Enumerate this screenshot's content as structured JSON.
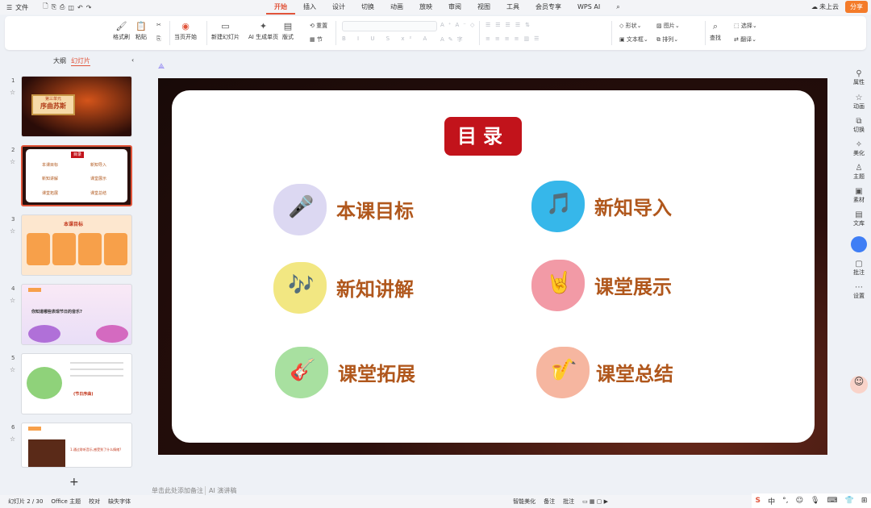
{
  "titlebar": {
    "menu_icon": "hamburger-icon",
    "file": "文件",
    "quick_icons": [
      "save-icon",
      "export-icon",
      "print-icon",
      "preview-icon",
      "undo-icon",
      "redo-icon"
    ]
  },
  "tabs": [
    "开始",
    "插入",
    "设计",
    "切换",
    "动画",
    "放映",
    "审阅",
    "视图",
    "工具",
    "会员专享",
    "WPS AI"
  ],
  "active_tab": "开始",
  "topright": {
    "cloud": "未上云",
    "share": "分享"
  },
  "ribbon": {
    "format_painter": "格式刷",
    "paste": "粘贴",
    "play_current": "当页开始",
    "new_slide": "新建幻灯片",
    "ai_slide": "AI 生成单页",
    "layout": "版式",
    "section": "节",
    "reset": "重置",
    "shape": "形状",
    "picture": "图片",
    "textbox": "文本框",
    "arrange": "排列",
    "find": "查找",
    "select": "选择",
    "replace": "翻译"
  },
  "left_panel": {
    "outline_tab": "大纲",
    "slides_tab": "幻灯片",
    "thumbs": [
      {
        "num": "1",
        "caption": "第三单元",
        "title": "序曲苏斯"
      },
      {
        "num": "2",
        "caption": "目录",
        "items": [
          "本课目标",
          "新知导入",
          "新知讲解",
          "课堂展示",
          "课堂拓展",
          "课堂总结"
        ]
      },
      {
        "num": "3",
        "title": "本课目标"
      },
      {
        "num": "4",
        "text": "你知道哪些表现节日的音乐?"
      },
      {
        "num": "5",
        "text": "(节日序曲)"
      },
      {
        "num": "6",
        "text": "1.通过聆听音乐,感受到了什么情绪?"
      }
    ]
  },
  "slide": {
    "title": "目录",
    "items": [
      {
        "label": "本课目标",
        "icon": "microphone-icon",
        "color": "#dcd8f2"
      },
      {
        "label": "新知导入",
        "icon": "music-note-icon",
        "color": "#36b7ea"
      },
      {
        "label": "新知讲解",
        "icon": "music-notes-icon",
        "color": "#f2e782"
      },
      {
        "label": "课堂展示",
        "icon": "rock-hand-icon",
        "color": "#f29aa6"
      },
      {
        "label": "课堂拓展",
        "icon": "guitar-icon",
        "color": "#a8e0a0"
      },
      {
        "label": "课堂总结",
        "icon": "saxophone-icon",
        "color": "#f6b6a0"
      }
    ]
  },
  "notes": {
    "placeholder": "单击此处添加备注",
    "ai": "AI 演讲稿"
  },
  "right_panel": [
    "属性",
    "动画",
    "切换",
    "美化",
    "主题",
    "素材",
    "文库",
    "批注",
    "设置"
  ],
  "status": {
    "slide_counter": "幻灯片 2 / 30",
    "theme": "Office 主题",
    "proof": "校对",
    "missing_font": "缺失字体",
    "smart": "智能美化",
    "notes": "备注",
    "comments": "批注",
    "zoom": "109%"
  },
  "ime": {
    "lang": "中"
  }
}
